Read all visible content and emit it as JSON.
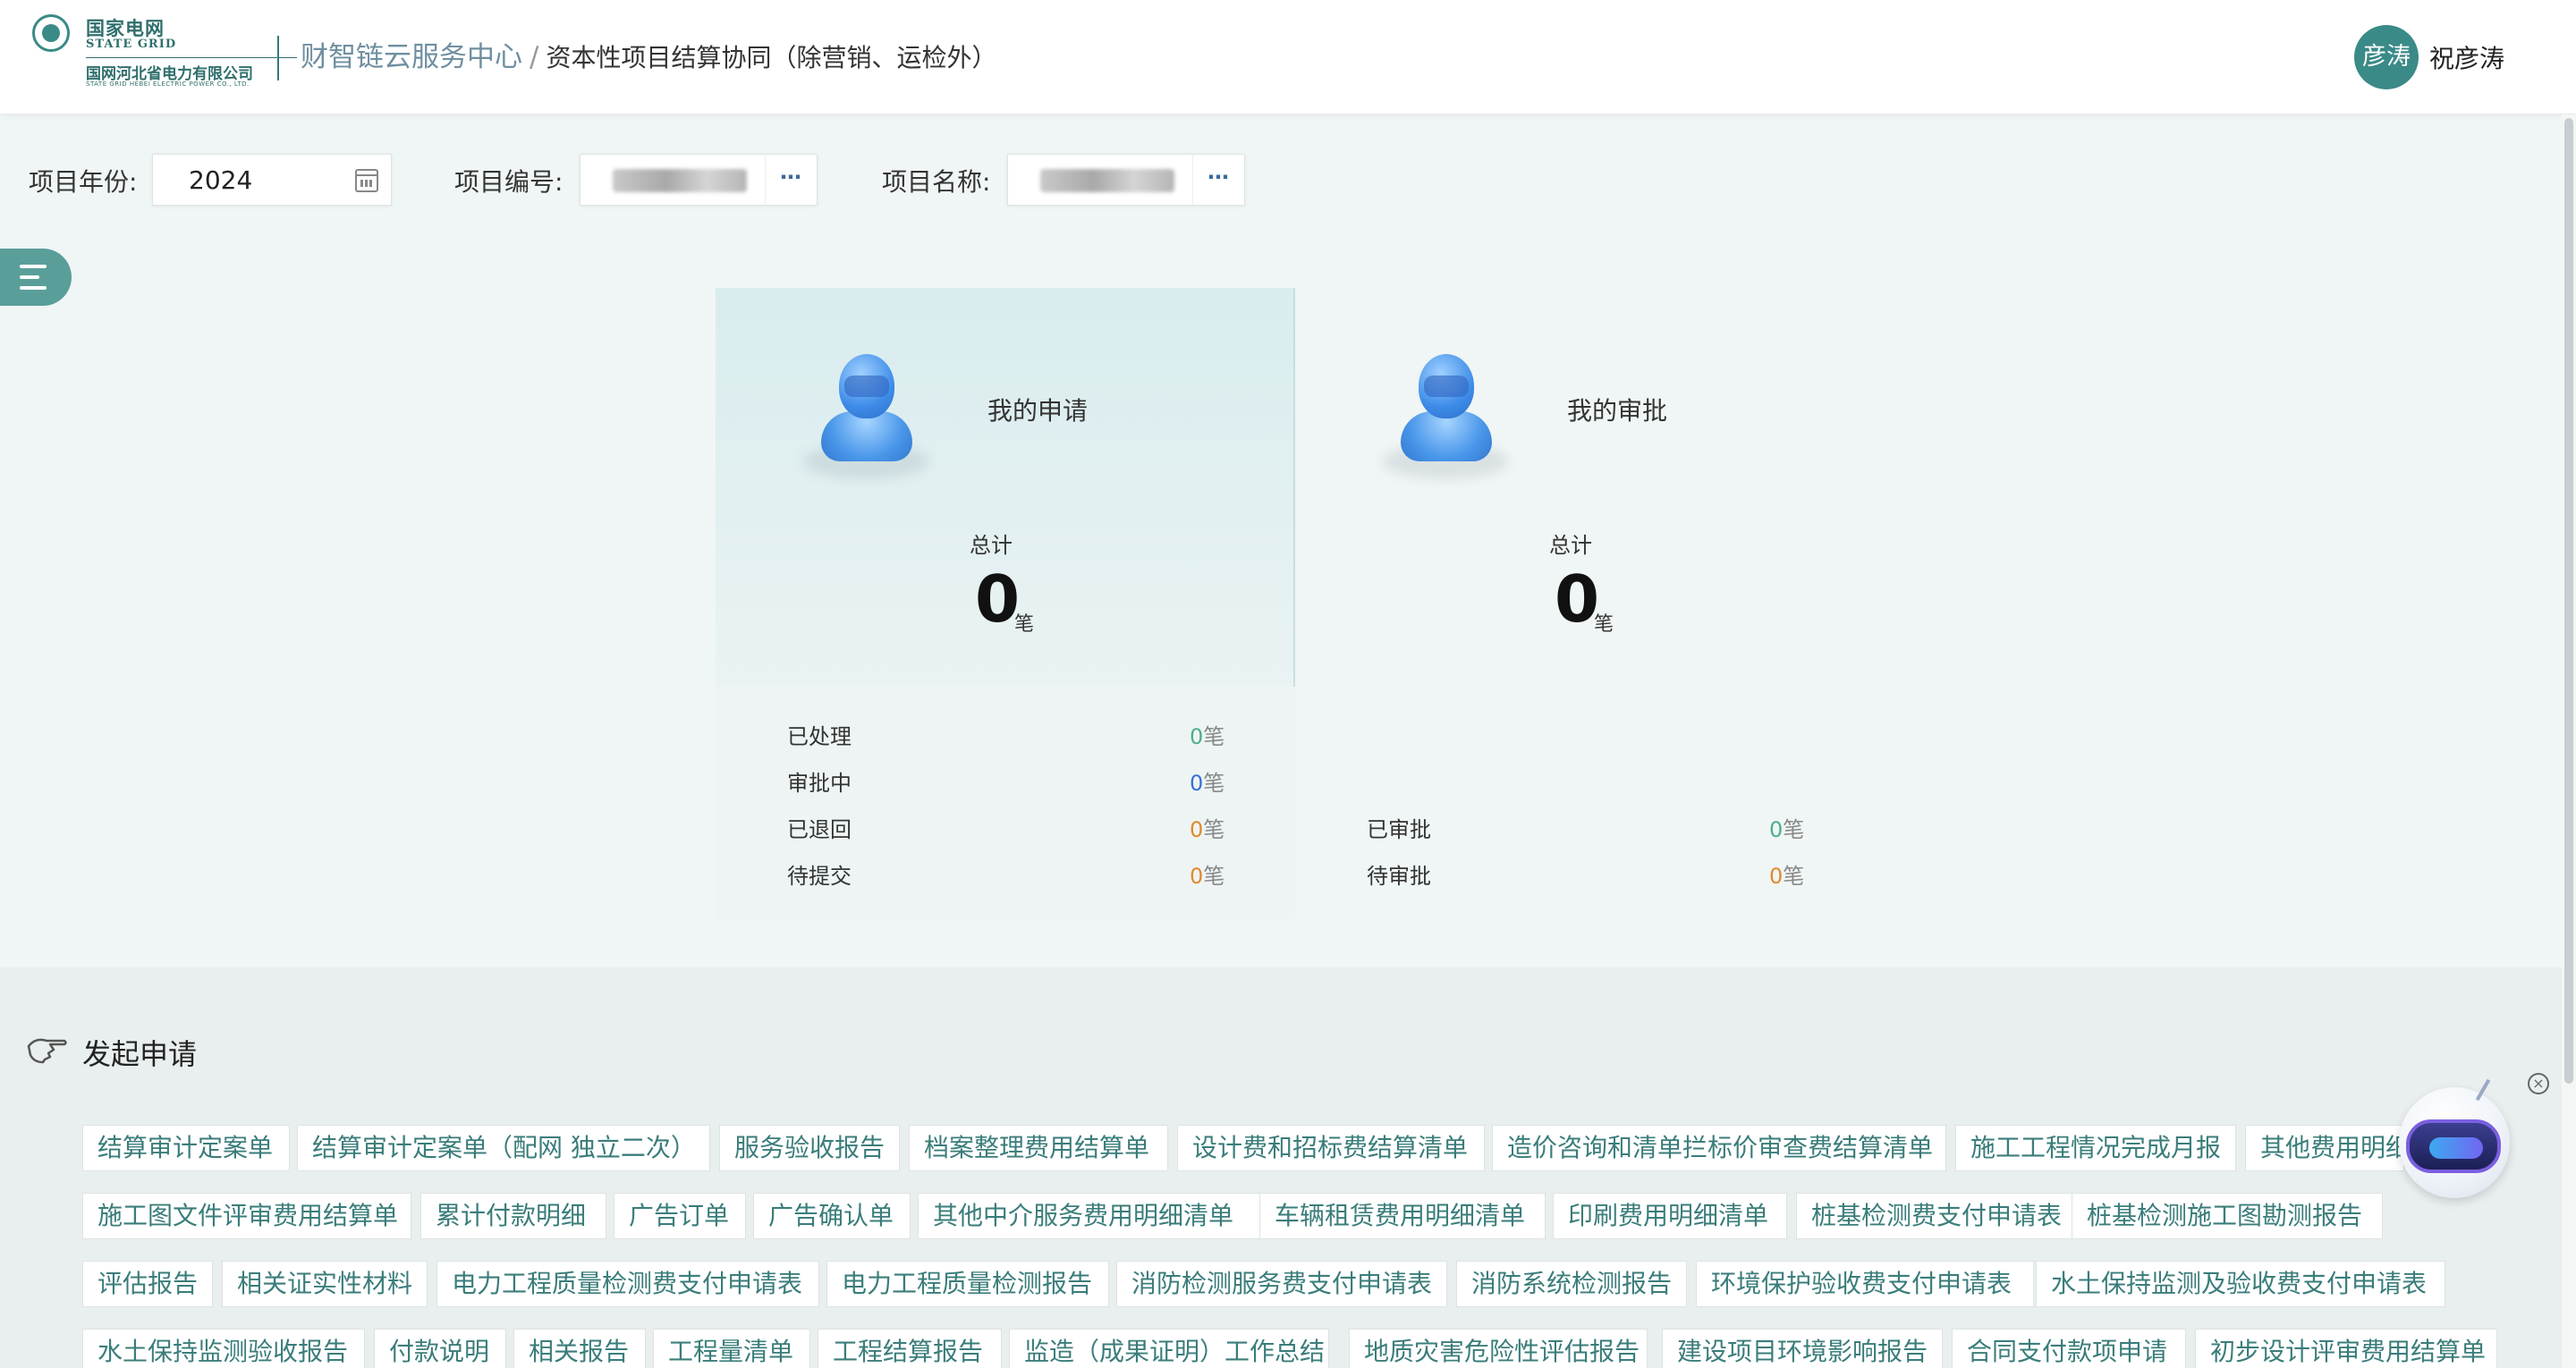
{
  "header": {
    "logo_cn": "国家电网",
    "logo_en": "STATE GRID",
    "logo_company": "国网河北省电力有限公司",
    "logo_company_en": "STATE GRID HEBEI ELECTRIC POWER CO., LTD.",
    "breadcrumb_home": "财智链云服务中心",
    "breadcrumb_sep": "/",
    "breadcrumb_current": "资本性项目结算协同（除营销、运检外）",
    "avatar_text": "彦涛",
    "username": "祝彦涛"
  },
  "filters": {
    "year_label": "项目年份:",
    "year_value": "2024",
    "code_label": "项目编号:",
    "name_label": "项目名称:",
    "more_icon": "⋯"
  },
  "stats": {
    "my_apply": {
      "title": "我的申请",
      "total_label": "总计",
      "total": "0",
      "unit": "笔",
      "rows": [
        {
          "label": "已处理",
          "value": "0",
          "unit": "笔",
          "color": "#4caf8a"
        },
        {
          "label": "审批中",
          "value": "0",
          "unit": "笔",
          "color": "#3a6fd8"
        },
        {
          "label": "已退回",
          "value": "0",
          "unit": "笔",
          "color": "#e08a2c"
        },
        {
          "label": "待提交",
          "value": "0",
          "unit": "笔",
          "color": "#e08a2c"
        }
      ]
    },
    "my_approve": {
      "title": "我的审批",
      "total_label": "总计",
      "total": "0",
      "unit": "笔",
      "rows": [
        {
          "label": "已审批",
          "value": "0",
          "unit": "笔",
          "color": "#4caf8a"
        },
        {
          "label": "待审批",
          "value": "0",
          "unit": "笔",
          "color": "#e08a2c"
        }
      ]
    }
  },
  "apply": {
    "title": "发起申请",
    "rows": [
      [
        "结算审计定案单",
        "结算审计定案单（配网 独立二次）",
        "服务验收报告",
        "档案整理费用结算单",
        "设计费和招标费结算清单",
        "造价咨询和清单拦标价审查费结算清单",
        "施工工程情况完成月报",
        "其他费用明细"
      ],
      [
        "施工图文件评审费用结算单",
        "累计付款明细",
        "广告订单",
        "广告确认单",
        "其他中介服务费用明细清单",
        "车辆租赁费用明细清单",
        "印刷费用明细清单",
        "桩基检测费支付申请表",
        "桩基检测施工图勘测报告"
      ],
      [
        "评估报告",
        "相关证实性材料",
        "电力工程质量检测费支付申请表",
        "电力工程质量检测报告",
        "消防检测服务费支付申请表",
        "消防系统检测报告",
        "环境保护验收费支付申请表",
        "水土保持监测及验收费支付申请表"
      ],
      [
        "水土保持监测验收报告",
        "付款说明",
        "相关报告",
        "工程量清单",
        "工程结算报告",
        "监造（成果证明）工作总结",
        "地质灾害危险性评估报告",
        "建设项目环境影响报告",
        "合同支付款项申请",
        "初步设计评审费用结算单"
      ]
    ]
  },
  "colors": {
    "brand": "#2f6f6c",
    "accent": "#3a8a87",
    "tag_text": "#3a7d7a"
  }
}
